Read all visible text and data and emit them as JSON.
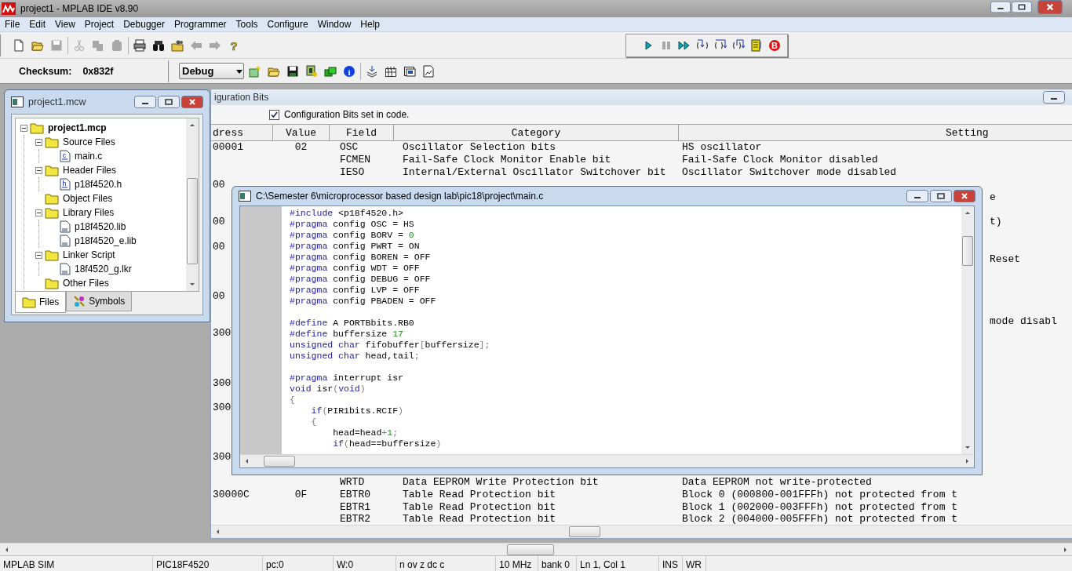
{
  "window": {
    "title": "project1 - MPLAB IDE v8.90"
  },
  "menu": [
    "File",
    "Edit",
    "View",
    "Project",
    "Debugger",
    "Programmer",
    "Tools",
    "Configure",
    "Window",
    "Help"
  ],
  "toolbar": {
    "groups": [
      [
        {
          "kind": "new-file",
          "disabled": false
        },
        {
          "kind": "open-folder",
          "disabled": false
        },
        {
          "kind": "save",
          "disabled": true
        }
      ],
      [
        {
          "kind": "cut",
          "disabled": true
        },
        {
          "kind": "copy",
          "disabled": true
        },
        {
          "kind": "paste",
          "disabled": true
        }
      ],
      [
        {
          "kind": "print",
          "disabled": false
        },
        {
          "kind": "find",
          "disabled": false
        },
        {
          "kind": "folder-gear",
          "disabled": false
        },
        {
          "kind": "back",
          "disabled": true
        },
        {
          "kind": "forward",
          "disabled": true
        },
        {
          "kind": "help",
          "disabled": false,
          "glyph": "?"
        }
      ]
    ]
  },
  "debug_toolbar": {
    "items": [
      {
        "kind": "run",
        "disabled": false
      },
      {
        "kind": "pause",
        "disabled": true
      },
      {
        "kind": "animate",
        "disabled": false
      },
      {
        "kind": "step-into",
        "disabled": false
      },
      {
        "kind": "step-over",
        "disabled": false
      },
      {
        "kind": "step-out",
        "disabled": false
      },
      {
        "kind": "reset",
        "disabled": false
      },
      {
        "kind": "breakpoint",
        "disabled": false,
        "glyph": "B"
      }
    ]
  },
  "build_toolbar": {
    "checksum_label": "Checksum:",
    "checksum": "0x832f",
    "configuration": "Debug",
    "groups": [
      [
        {
          "kind": "new-project",
          "disabled": false
        },
        {
          "kind": "open-folder",
          "disabled": false
        },
        {
          "kind": "save-dark",
          "disabled": false
        },
        {
          "kind": "build",
          "disabled": false
        },
        {
          "kind": "make",
          "disabled": false
        },
        {
          "kind": "info",
          "disabled": false,
          "glyph": "i"
        }
      ],
      [
        {
          "kind": "layers",
          "disabled": false
        },
        {
          "kind": "grid",
          "disabled": false
        },
        {
          "kind": "window",
          "disabled": false
        },
        {
          "kind": "chart",
          "disabled": false
        }
      ]
    ]
  },
  "project_window": {
    "title": "project1.mcw",
    "tree": [
      {
        "label": "project1.mcp",
        "kind": "project",
        "expanded": true,
        "children": [
          {
            "label": "Source Files",
            "kind": "folder",
            "expanded": true,
            "children": [
              {
                "label": "main.c",
                "kind": "file",
                "glyph": "c"
              }
            ]
          },
          {
            "label": "Header Files",
            "kind": "folder",
            "expanded": true,
            "children": [
              {
                "label": "p18f4520.h",
                "kind": "file",
                "glyph": "h"
              }
            ]
          },
          {
            "label": "Object Files",
            "kind": "folder"
          },
          {
            "label": "Library Files",
            "kind": "folder",
            "expanded": true,
            "children": [
              {
                "label": "p18f4520.lib",
                "kind": "file"
              },
              {
                "label": "p18f4520_e.lib",
                "kind": "file"
              }
            ]
          },
          {
            "label": "Linker Script",
            "kind": "folder",
            "expanded": true,
            "children": [
              {
                "label": "18f4520_g.lkr",
                "kind": "file"
              }
            ]
          },
          {
            "label": "Other Files",
            "kind": "folder"
          }
        ]
      }
    ],
    "tabs": [
      {
        "label": "Files",
        "selected": true
      },
      {
        "label": "Symbols",
        "selected": false
      }
    ]
  },
  "config_window": {
    "title": "iguration Bits",
    "set_in_code": {
      "label": "Configuration Bits set in code.",
      "checked": true
    },
    "columns": [
      "dress",
      "Value",
      "Field",
      "Category",
      "Setting"
    ],
    "rows": [
      {
        "kind": "entry",
        "address": "00001",
        "value": "02",
        "field": "OSC",
        "category": "Oscillator Selection bits",
        "setting": "HS oscillator"
      },
      {
        "kind": "entry",
        "field": "FCMEN",
        "category": "Fail-Safe Clock Monitor Enable bit",
        "setting": "Fail-Safe Clock Monitor disabled"
      },
      {
        "kind": "entry",
        "field": "IESO",
        "category": "Internal/External Oscillator Switchover bit",
        "setting": "Oscillator Switchover mode disabled"
      },
      {
        "kind": "entry",
        "address": "00"
      },
      {
        "kind": "entry",
        "setting_tail": "e"
      },
      {
        "kind": "blank"
      },
      {
        "kind": "entry",
        "address": "00",
        "setting_tail": "t)"
      },
      {
        "kind": "blank"
      },
      {
        "kind": "entry",
        "address": "00"
      },
      {
        "kind": "entry",
        "setting_tail": "Reset"
      },
      {
        "kind": "blank"
      },
      {
        "kind": "blank"
      },
      {
        "kind": "entry",
        "address": "00"
      },
      {
        "kind": "blank"
      },
      {
        "kind": "entry",
        "setting_tail": "mode disabl"
      },
      {
        "kind": "entry",
        "address": "300"
      },
      {
        "kind": "blank"
      },
      {
        "kind": "blank"
      },
      {
        "kind": "blank"
      },
      {
        "kind": "entry",
        "address": "300"
      },
      {
        "kind": "blank"
      },
      {
        "kind": "entry",
        "address": "300"
      },
      {
        "kind": "blank"
      },
      {
        "kind": "blank"
      },
      {
        "kind": "blank"
      },
      {
        "kind": "entry",
        "address": "300"
      },
      {
        "kind": "blank"
      },
      {
        "kind": "entry",
        "field": "WRTD",
        "category": "Data EEPROM Write Protection bit",
        "setting": "Data EEPROM not write-protected"
      },
      {
        "kind": "entry",
        "address": "30000C",
        "value": "0F",
        "field": "EBTR0",
        "category": "Table Read Protection bit",
        "setting": "Block 0 (000800-001FFFh) not protected from t"
      },
      {
        "kind": "entry",
        "field": "EBTR1",
        "category": "Table Read Protection bit",
        "setting": "Block 1 (002000-003FFFh) not protected from t"
      },
      {
        "kind": "entry",
        "field": "EBTR2",
        "category": "Table Read Protection bit",
        "setting": "Block 2 (004000-005FFFh) not protected from t"
      }
    ]
  },
  "editor": {
    "title": "C:\\Semester 6\\microprocessor based design lab\\pic18\\project\\main.c",
    "lines": [
      {
        "kind": "code",
        "tokens": [
          {
            "kind": "kw",
            "text": "#include"
          },
          {
            "kind": "text",
            "text": " <p18f4520.h>"
          }
        ]
      },
      {
        "kind": "code",
        "tokens": [
          {
            "kind": "kw",
            "text": "#pragma"
          },
          {
            "kind": "text",
            "text": " config OSC = HS"
          }
        ]
      },
      {
        "kind": "code",
        "tokens": [
          {
            "kind": "kw",
            "text": "#pragma"
          },
          {
            "kind": "text",
            "text": " config BORV = "
          },
          {
            "kind": "num",
            "text": "0"
          }
        ]
      },
      {
        "kind": "code",
        "tokens": [
          {
            "kind": "kw",
            "text": "#pragma"
          },
          {
            "kind": "text",
            "text": " config PWRT = ON"
          }
        ]
      },
      {
        "kind": "code",
        "tokens": [
          {
            "kind": "kw",
            "text": "#pragma"
          },
          {
            "kind": "text",
            "text": " config BOREN = OFF"
          }
        ]
      },
      {
        "kind": "code",
        "tokens": [
          {
            "kind": "kw",
            "text": "#pragma"
          },
          {
            "kind": "text",
            "text": " config WDT = OFF"
          }
        ]
      },
      {
        "kind": "code",
        "tokens": [
          {
            "kind": "kw",
            "text": "#pragma"
          },
          {
            "kind": "text",
            "text": " config DEBUG = OFF"
          }
        ]
      },
      {
        "kind": "code",
        "tokens": [
          {
            "kind": "kw",
            "text": "#pragma"
          },
          {
            "kind": "text",
            "text": " config LVP = OFF"
          }
        ]
      },
      {
        "kind": "code",
        "tokens": [
          {
            "kind": "kw",
            "text": "#pragma"
          },
          {
            "kind": "text",
            "text": " config PBADEN = OFF"
          }
        ]
      },
      {
        "kind": "blank"
      },
      {
        "kind": "code",
        "tokens": [
          {
            "kind": "kw",
            "text": "#define"
          },
          {
            "kind": "text",
            "text": " A PORTBbits.RB0"
          }
        ]
      },
      {
        "kind": "code",
        "tokens": [
          {
            "kind": "kw",
            "text": "#define"
          },
          {
            "kind": "text",
            "text": " buffersize "
          },
          {
            "kind": "num",
            "text": "17"
          }
        ]
      },
      {
        "kind": "code",
        "tokens": [
          {
            "kind": "kw",
            "text": "unsigned char"
          },
          {
            "kind": "text",
            "text": " fifobuffer"
          },
          {
            "kind": "punct",
            "text": "["
          },
          {
            "kind": "text",
            "text": "buffersize"
          },
          {
            "kind": "punct",
            "text": "];"
          }
        ]
      },
      {
        "kind": "code",
        "tokens": [
          {
            "kind": "kw",
            "text": "unsigned char"
          },
          {
            "kind": "text",
            "text": " head,tail"
          },
          {
            "kind": "punct",
            "text": ";"
          }
        ]
      },
      {
        "kind": "blank"
      },
      {
        "kind": "code",
        "tokens": [
          {
            "kind": "kw",
            "text": "#pragma"
          },
          {
            "kind": "text",
            "text": " interrupt isr"
          }
        ]
      },
      {
        "kind": "code",
        "tokens": [
          {
            "kind": "kw",
            "text": "void"
          },
          {
            "kind": "text",
            "text": " isr"
          },
          {
            "kind": "punct",
            "text": "("
          },
          {
            "kind": "kw",
            "text": "void"
          },
          {
            "kind": "punct",
            "text": ")"
          }
        ]
      },
      {
        "kind": "code",
        "tokens": [
          {
            "kind": "punct",
            "text": "{"
          }
        ]
      },
      {
        "kind": "code",
        "tokens": [
          {
            "kind": "kw",
            "text": "    if"
          },
          {
            "kind": "punct",
            "text": "("
          },
          {
            "kind": "text",
            "text": "PIR1bits.RCIF"
          },
          {
            "kind": "punct",
            "text": ")"
          }
        ]
      },
      {
        "kind": "code",
        "tokens": [
          {
            "kind": "punct",
            "text": "    {"
          }
        ]
      },
      {
        "kind": "code",
        "tokens": [
          {
            "kind": "text",
            "text": "        head=head"
          },
          {
            "kind": "punct",
            "text": "+"
          },
          {
            "kind": "num",
            "text": "1"
          },
          {
            "kind": "punct",
            "text": ";"
          }
        ]
      },
      {
        "kind": "code",
        "tokens": [
          {
            "kind": "kw",
            "text": "        if"
          },
          {
            "kind": "punct",
            "text": "("
          },
          {
            "kind": "text",
            "text": "head==buffersize"
          },
          {
            "kind": "punct",
            "text": ")"
          }
        ]
      }
    ]
  },
  "status_bar": [
    "MPLAB SIM",
    "PIC18F4520",
    "pc:0",
    "W:0",
    "n ov z dc c",
    "10 MHz",
    "bank 0",
    "Ln 1, Col 1",
    "INS",
    "WR"
  ]
}
